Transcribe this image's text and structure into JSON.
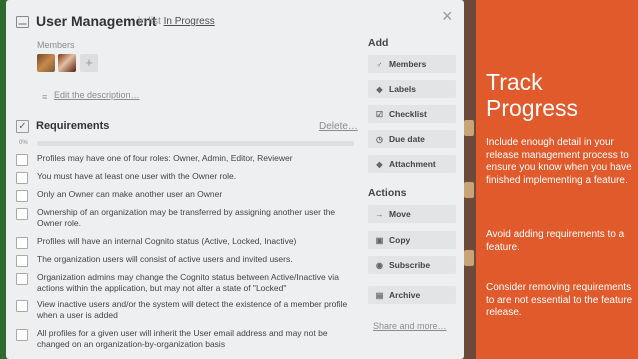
{
  "card": {
    "title": "User Management",
    "in_list_prefix": "in list",
    "list_name": "In Progress",
    "close_glyph": "×"
  },
  "members": {
    "label": "Members",
    "add_glyph": "+"
  },
  "description": {
    "icon": "≡",
    "link": "Edit the description…"
  },
  "checklist": {
    "title": "Requirements",
    "delete": "Delete…",
    "progress_percent": "0%",
    "progress_value": 0,
    "items": [
      {
        "text": "Profiles may have one of four roles: Owner, Admin, Editor, Reviewer"
      },
      {
        "text": "You must have at least one user with the Owner role."
      },
      {
        "text": "Only an Owner can make another user an Owner"
      },
      {
        "text": "Ownership of an organization may be transferred by assigning another user the Owner role."
      },
      {
        "text": "Profiles will have an internal Cognito status (Active, Locked, Inactive)"
      },
      {
        "text": "The organization users will consist of active users and invited users."
      },
      {
        "text": "Organization admins may change the Cognito status between Active/Inactive via actions within the application, but may not alter a state of \"Locked\""
      },
      {
        "text": "View inactive users and/or the system will detect the existence of a member profile when a user is added"
      },
      {
        "text": "All profiles for a given user will inherit the User email address and may not be changed on an organization-by-organization basis"
      }
    ]
  },
  "sidebar": {
    "add_heading": "Add",
    "add_buttons": [
      {
        "label": "Members",
        "icon": "person-icon",
        "glyph": "♂"
      },
      {
        "label": "Labels",
        "icon": "tag-icon",
        "glyph": "◆"
      },
      {
        "label": "Checklist",
        "icon": "checkbox-icon",
        "glyph": "☑"
      },
      {
        "label": "Due date",
        "icon": "clock-icon",
        "glyph": "◷"
      },
      {
        "label": "Attachment",
        "icon": "paperclip-icon",
        "glyph": "◆"
      }
    ],
    "actions_heading": "Actions",
    "action_buttons": [
      {
        "label": "Move",
        "icon": "arrow-right-icon",
        "glyph": "→"
      },
      {
        "label": "Copy",
        "icon": "copy-icon",
        "glyph": "▣"
      },
      {
        "label": "Subscribe",
        "icon": "eye-icon",
        "glyph": "◉"
      },
      {
        "label": "Archive",
        "icon": "archive-icon",
        "glyph": "▤"
      }
    ],
    "share": "Share and more…"
  },
  "panel": {
    "title": "Track Progress",
    "paragraphs": [
      "Include enough detail in your release management process to ensure you know when you have finished implementing a feature.",
      "Avoid adding requirements to a feature.",
      "Consider removing requirements to are not essential to the feature release."
    ]
  },
  "colors": {
    "panel": "#e05a2b",
    "card": "#edeff0"
  }
}
